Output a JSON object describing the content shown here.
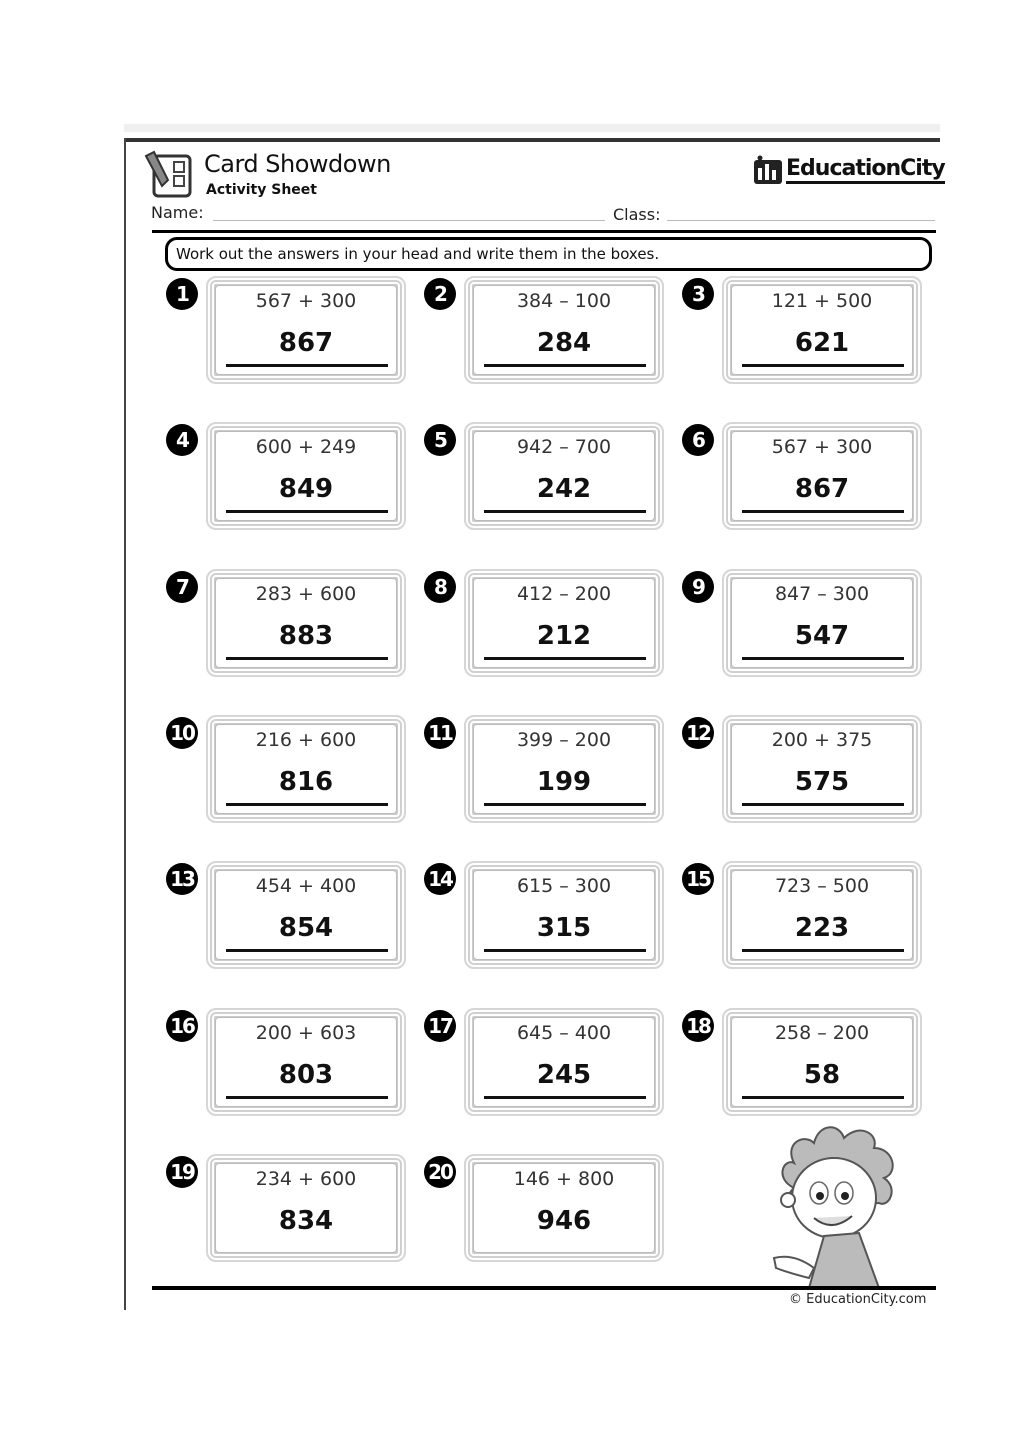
{
  "header": {
    "title": "Card Showdown",
    "subtitle": "Activity Sheet",
    "brand": "EducationCity",
    "name_label": "Name:",
    "class_label": "Class:",
    "instructions": "Work out the answers in your head and write them in the boxes."
  },
  "cards": [
    {
      "num": "1",
      "question": "567 + 300",
      "answer": "867"
    },
    {
      "num": "2",
      "question": "384 – 100",
      "answer": "284"
    },
    {
      "num": "3",
      "question": "121 + 500",
      "answer": "621"
    },
    {
      "num": "4",
      "question": "600 + 249",
      "answer": "849"
    },
    {
      "num": "5",
      "question": "942 – 700",
      "answer": "242"
    },
    {
      "num": "6",
      "question": "567 + 300",
      "answer": "867"
    },
    {
      "num": "7",
      "question": "283 + 600",
      "answer": "883"
    },
    {
      "num": "8",
      "question": "412 – 200",
      "answer": "212"
    },
    {
      "num": "9",
      "question": "847 – 300",
      "answer": "547"
    },
    {
      "num": "10",
      "question": "216 + 600",
      "answer": "816"
    },
    {
      "num": "11",
      "question": "399 – 200",
      "answer": "199"
    },
    {
      "num": "12",
      "question": "200 + 375",
      "answer": "575"
    },
    {
      "num": "13",
      "question": "454 + 400",
      "answer": "854"
    },
    {
      "num": "14",
      "question": "615 – 300",
      "answer": "315"
    },
    {
      "num": "15",
      "question": "723 – 500",
      "answer": "223"
    },
    {
      "num": "16",
      "question": "200 + 603",
      "answer": "803"
    },
    {
      "num": "17",
      "question": "645 – 400",
      "answer": "245"
    },
    {
      "num": "18",
      "question": "258 – 200",
      "answer": "58"
    },
    {
      "num": "19",
      "question": "234 + 600",
      "answer": "834"
    },
    {
      "num": "20",
      "question": "146 + 800",
      "answer": "946"
    }
  ],
  "footer": {
    "copyright": "© EducationCity.com"
  }
}
